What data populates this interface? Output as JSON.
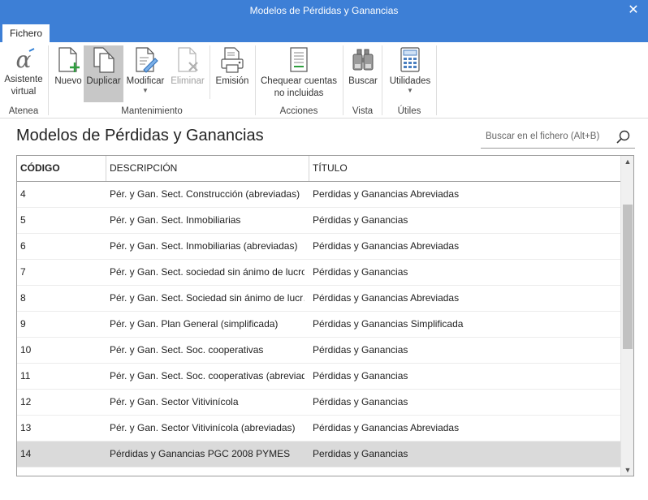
{
  "window": {
    "title": "Modelos de Pérdidas y Ganancias",
    "close_glyph": "✕"
  },
  "tabs": [
    {
      "label": "Fichero",
      "active": true
    }
  ],
  "ribbon": {
    "groups": [
      {
        "label": "Atenea",
        "buttons": [
          {
            "label": "Asistente virtual",
            "icon": "alpha-icon"
          }
        ]
      },
      {
        "label": "Mantenimiento",
        "buttons": [
          {
            "label": "Nuevo",
            "icon": "new-document-icon"
          },
          {
            "label": "Duplicar",
            "icon": "duplicate-icon",
            "active": true
          },
          {
            "label": "Modificar",
            "icon": "edit-document-icon",
            "dropdown": true
          },
          {
            "label": "Eliminar",
            "icon": "delete-document-icon",
            "disabled": true
          },
          {
            "label": "Emisión",
            "icon": "print-icon"
          }
        ]
      },
      {
        "label": "Acciones",
        "buttons": [
          {
            "label": "Chequear cuentas no incluidas",
            "icon": "check-accounts-icon"
          }
        ]
      },
      {
        "label": "Vista",
        "buttons": [
          {
            "label": "Buscar",
            "icon": "binoculars-icon"
          }
        ]
      },
      {
        "label": "Útiles",
        "buttons": [
          {
            "label": "Utilidades",
            "icon": "calculator-icon",
            "dropdown": true
          }
        ]
      }
    ]
  },
  "page_title": "Modelos de Pérdidas y Ganancias",
  "search": {
    "placeholder": "Buscar en el fichero (Alt+B)",
    "icon": "search-icon"
  },
  "table": {
    "columns": [
      "CÓDIGO",
      "DESCRIPCIÓN",
      "TÍTULO"
    ],
    "rows": [
      [
        "4",
        "Pér. y Gan. Sect. Construcción (abreviadas)",
        "Perdidas y Ganancias Abreviadas"
      ],
      [
        "5",
        "Pér. y Gan. Sect. Inmobiliarias",
        "Pérdidas y Ganancias"
      ],
      [
        "6",
        "Pér. y Gan. Sect. Inmobiliarias (abreviadas)",
        "Pérdidas y Ganancias Abreviadas"
      ],
      [
        "7",
        "Pér. y Gan. Sect. sociedad sin ánimo de lucro.",
        "Pérdidas y Ganancias"
      ],
      [
        "8",
        "Pér. y Gan. Sect. Sociedad sin ánimo de lucr…",
        "Pérdidas y Ganancias Abreviadas"
      ],
      [
        "9",
        "Pér. y Gan. Plan General (simplificada)",
        "Pérdidas y Ganancias Simplificada"
      ],
      [
        "10",
        "Pér. y Gan. Sect. Soc. cooperativas",
        "Pérdidas y Ganancias"
      ],
      [
        "11",
        "Pér. y Gan. Sect. Soc. cooperativas (abreviad…",
        "Pérdidas y Ganancias"
      ],
      [
        "12",
        "Pér. y Gan. Sector Vitivinícola",
        "Pérdidas y Ganancias"
      ],
      [
        "13",
        "Pér. y Gan. Sector Vitivinícola (abreviadas)",
        "Pérdidas y Ganancias Abreviadas"
      ],
      [
        "14",
        "Pérdidas y Ganancias PGC 2008 PYMES",
        "Perdidas y Ganancias"
      ]
    ],
    "selected_row": 10
  },
  "colors": {
    "titlebar": "#3d7fd6",
    "accent_green": "#2e9e3e",
    "selected_row": "#dadada"
  }
}
